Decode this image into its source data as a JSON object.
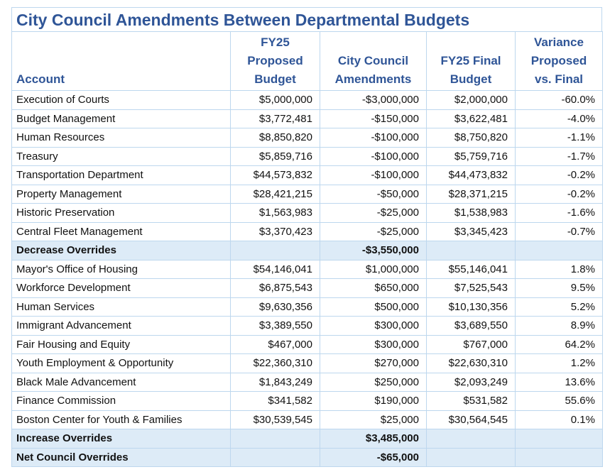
{
  "title": "City Council Amendments Between Departmental Budgets",
  "headers": {
    "account": "Account",
    "proposed": [
      "FY25",
      "Proposed",
      "Budget"
    ],
    "amendments": [
      "City Council",
      "Amendments"
    ],
    "final": [
      "FY25 Final",
      "Budget"
    ],
    "variance": [
      "Variance",
      "Proposed",
      "vs. Final"
    ]
  },
  "decrease_rows": [
    {
      "account": "Execution of Courts",
      "proposed": "$5,000,000",
      "amendment": "-$3,000,000",
      "final": "$2,000,000",
      "variance": "-60.0%"
    },
    {
      "account": "Budget Management",
      "proposed": "$3,772,481",
      "amendment": "-$150,000",
      "final": "$3,622,481",
      "variance": "-4.0%"
    },
    {
      "account": "Human Resources",
      "proposed": "$8,850,820",
      "amendment": "-$100,000",
      "final": "$8,750,820",
      "variance": "-1.1%"
    },
    {
      "account": "Treasury",
      "proposed": "$5,859,716",
      "amendment": "-$100,000",
      "final": "$5,759,716",
      "variance": "-1.7%"
    },
    {
      "account": "Transportation Department",
      "proposed": "$44,573,832",
      "amendment": "-$100,000",
      "final": "$44,473,832",
      "variance": "-0.2%"
    },
    {
      "account": "Property Management",
      "proposed": "$28,421,215",
      "amendment": "-$50,000",
      "final": "$28,371,215",
      "variance": "-0.2%"
    },
    {
      "account": "Historic Preservation",
      "proposed": "$1,563,983",
      "amendment": "-$25,000",
      "final": "$1,538,983",
      "variance": "-1.6%"
    },
    {
      "account": "Central Fleet Management",
      "proposed": "$3,370,423",
      "amendment": "-$25,000",
      "final": "$3,345,423",
      "variance": "-0.7%"
    }
  ],
  "decrease_total": {
    "label": "Decrease Overrides",
    "amendment": "-$3,550,000"
  },
  "increase_rows": [
    {
      "account": "Mayor's Office of Housing",
      "proposed": "$54,146,041",
      "amendment": "$1,000,000",
      "final": "$55,146,041",
      "variance": "1.8%"
    },
    {
      "account": "Workforce Development",
      "proposed": "$6,875,543",
      "amendment": "$650,000",
      "final": "$7,525,543",
      "variance": "9.5%"
    },
    {
      "account": "Human Services",
      "proposed": "$9,630,356",
      "amendment": "$500,000",
      "final": "$10,130,356",
      "variance": "5.2%"
    },
    {
      "account": "Immigrant Advancement",
      "proposed": "$3,389,550",
      "amendment": "$300,000",
      "final": "$3,689,550",
      "variance": "8.9%"
    },
    {
      "account": "Fair Housing and Equity",
      "proposed": "$467,000",
      "amendment": "$300,000",
      "final": "$767,000",
      "variance": "64.2%"
    },
    {
      "account": "Youth Employment & Opportunity",
      "proposed": "$22,360,310",
      "amendment": "$270,000",
      "final": "$22,630,310",
      "variance": "1.2%"
    },
    {
      "account": "Black Male Advancement",
      "proposed": "$1,843,249",
      "amendment": "$250,000",
      "final": "$2,093,249",
      "variance": "13.6%"
    },
    {
      "account": "Finance Commission",
      "proposed": "$341,582",
      "amendment": "$190,000",
      "final": "$531,582",
      "variance": "55.6%"
    },
    {
      "account": "Boston Center for Youth & Families",
      "proposed": "$30,539,545",
      "amendment": "$25,000",
      "final": "$30,564,545",
      "variance": "0.1%"
    }
  ],
  "increase_total": {
    "label": "Increase Overrides",
    "amendment": "$3,485,000"
  },
  "net_total": {
    "label": "Net Council Overrides",
    "amendment": "-$65,000"
  },
  "colors": {
    "title": "#2f5597",
    "header": "#2f5597",
    "summary_fill": "#ddebf7",
    "grid": "#bdd7ee"
  }
}
